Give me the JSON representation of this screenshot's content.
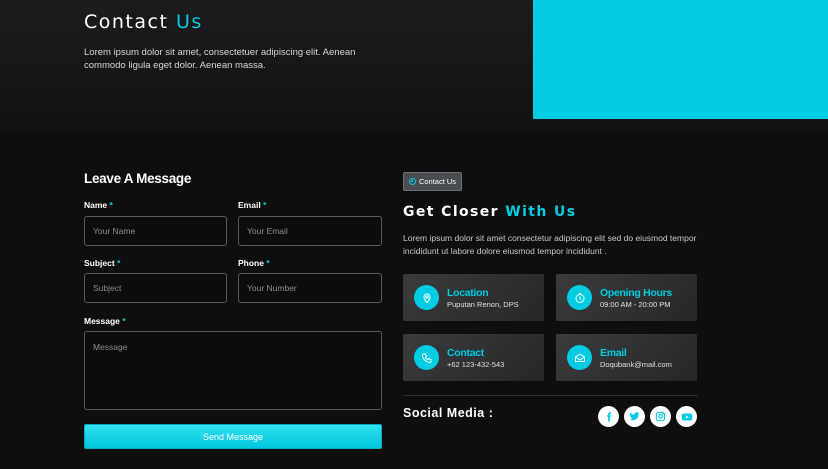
{
  "hero": {
    "title_main": "Contact",
    "title_accent": "Us",
    "description": "Lorem ipsum dolor sit amet, consectetuer adipiscing elit. Aenean commodo ligula eget dolor. Aenean massa."
  },
  "form": {
    "heading": "Leave A Message",
    "required_mark": "*",
    "name": {
      "label": "Name",
      "placeholder": "Your Name",
      "value": ""
    },
    "email": {
      "label": "Email",
      "placeholder": "Your Email",
      "value": ""
    },
    "subject": {
      "label": "Subject",
      "placeholder": "Subject",
      "value": ""
    },
    "phone": {
      "label": "Phone",
      "placeholder": "Your Number",
      "value": ""
    },
    "message": {
      "label": "Message",
      "placeholder": "Message",
      "value": ""
    },
    "submit_label": "Send Message"
  },
  "info": {
    "tag_label": "Contact Us",
    "title_main": "Get Closer",
    "title_accent": "With Us",
    "description": "Lorem ipsum dolor sit amet consectetur adipiscing elit sed do eiusmod tempor incididunt ut labore dolore eiusmod tempor incididunt .",
    "cards": [
      {
        "title": "Location",
        "detail": "Puputan Renon, DPS",
        "icon": "location-pin-icon"
      },
      {
        "title": "Opening Hours",
        "detail": "09:00 AM - 20:00 PM",
        "icon": "clock-icon"
      },
      {
        "title": "Contact",
        "detail": "+62 123-432-543",
        "icon": "phone-icon"
      },
      {
        "title": "Email",
        "detail": "Doqubank@mail.com",
        "icon": "envelope-icon"
      }
    ]
  },
  "social": {
    "label": "Social Media :",
    "icons": [
      "facebook-icon",
      "twitter-icon",
      "instagram-icon",
      "youtube-icon"
    ]
  },
  "colors": {
    "accent": "#00cde3",
    "background": "#0e0e0f",
    "card": "#2f3032"
  }
}
